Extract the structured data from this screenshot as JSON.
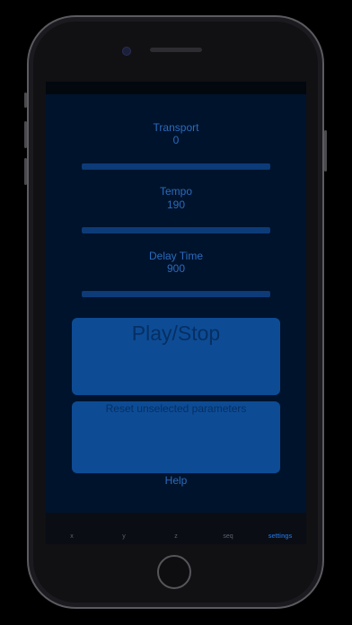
{
  "parameters": [
    {
      "label": "Transport",
      "value": "0"
    },
    {
      "label": "Tempo",
      "value": "190"
    },
    {
      "label": "Delay Time",
      "value": "900"
    }
  ],
  "buttons": {
    "play_stop": "Play/Stop",
    "reset": "Reset unselected parameters",
    "help": "Help"
  },
  "tabs": [
    {
      "label": "x",
      "active": false
    },
    {
      "label": "y",
      "active": false
    },
    {
      "label": "z",
      "active": false
    },
    {
      "label": "seq",
      "active": false
    },
    {
      "label": "settings",
      "active": true
    }
  ],
  "colors": {
    "screen_bg": "#00132d",
    "accent": "#2b6bbb",
    "button_bg": "#0d4c95",
    "active_tab": "#1d62c0"
  }
}
